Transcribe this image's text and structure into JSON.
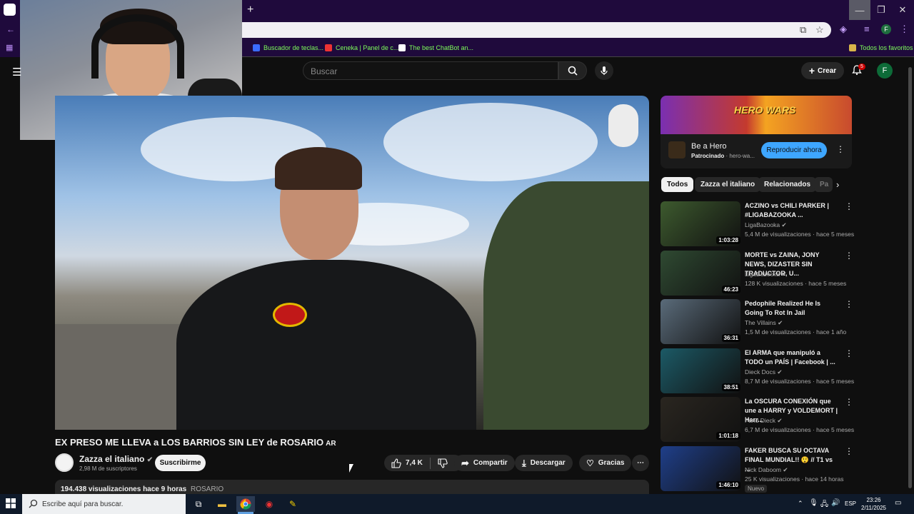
{
  "browser": {
    "bookmarks": [
      {
        "label": "Buscador de teclas...",
        "color": "#3b6cff"
      },
      {
        "label": "Ceneka | Panel de c...",
        "color": "#e33"
      },
      {
        "label": "The best ChatBot an...",
        "color": "#fff"
      }
    ],
    "all_bookmarks": "Todos los favoritos",
    "profile_letter": "F"
  },
  "youtube": {
    "search_placeholder": "Buscar",
    "create_label": "Crear",
    "notifications_count": "5",
    "avatar_letter": "F"
  },
  "video": {
    "title": "EX PRESO ME LLEVA a LOS BARRIOS SIN LEY de ROSARIO",
    "title_flag": "AR",
    "channel": "Zazza el italiano",
    "subscribers": "2,98 M de suscriptores",
    "subscribe_label": "Suscribirme",
    "likes": "7,4 K",
    "share_label": "Compartir",
    "download_label": "Descargar",
    "thanks_label": "Gracias",
    "views": "194.438 visualizaciones",
    "time_ago": "hace 9 horas",
    "hashtag": "ROSARIO"
  },
  "ad": {
    "brand": "HERO WARS",
    "title": "Be a Hero",
    "sponsored": "Patrocinado",
    "domain": "· hero-wa...",
    "cta": "Reproducir ahora"
  },
  "chips": [
    "Todos",
    "Zazza el italiano",
    "Relacionados",
    "Pa"
  ],
  "recommendations": [
    {
      "title": "ACZINO vs CHILI PARKER | #LIGABAZOOKA ...",
      "channel": "LigaBazooka",
      "meta": "5,4 M de visualizaciones · hace 5 meses",
      "duration": "1:03:28",
      "badge": "",
      "thumb_color": "#3d5a2e"
    },
    {
      "title": "MORTE vs ZAINA, JONY NEWS, DIZASTER SIN TRADUCTOR, U...",
      "channel": "LigaBazooka",
      "meta": "128 K visualizaciones · hace 5 meses",
      "duration": "46:23",
      "badge": "",
      "thumb_color": "#2f4a32"
    },
    {
      "title": "Pedophile Realized He Is Going To Rot In Jail",
      "channel": "The Villains",
      "meta": "1,5 M de visualizaciones · hace 1 año",
      "duration": "36:31",
      "badge": "",
      "thumb_color": "#5a6b7a"
    },
    {
      "title": "El ARMA que manipuló a TODO un PAÍS | Facebook | ...",
      "channel": "Dieck Docs",
      "meta": "8,7 M de visualizaciones · hace 5 meses",
      "duration": "38:51",
      "badge": "",
      "thumb_color": "#1c5a66"
    },
    {
      "title": "La OSCURA CONEXIÓN que une a HARRY y VOLDEMORT | Harr...",
      "channel": "Farid Dieck",
      "meta": "6,7 M de visualizaciones · hace 5 meses",
      "duration": "1:01:18",
      "badge": "",
      "thumb_color": "#2a2620"
    },
    {
      "title": "FAKER BUSCA SU OCTAVA FINAL MUNDIAL!! 😲 // T1 vs ...",
      "channel": "Nick Daboom",
      "meta": "25 K visualizaciones · hace 14 horas",
      "duration": "1:46:10",
      "badge": "Nuevo",
      "thumb_color": "#1f3f8a"
    }
  ],
  "taskbar": {
    "search_placeholder": "Escribe aquí para buscar.",
    "language": "ESP",
    "time": "23:26",
    "date": "2/11/2025"
  }
}
